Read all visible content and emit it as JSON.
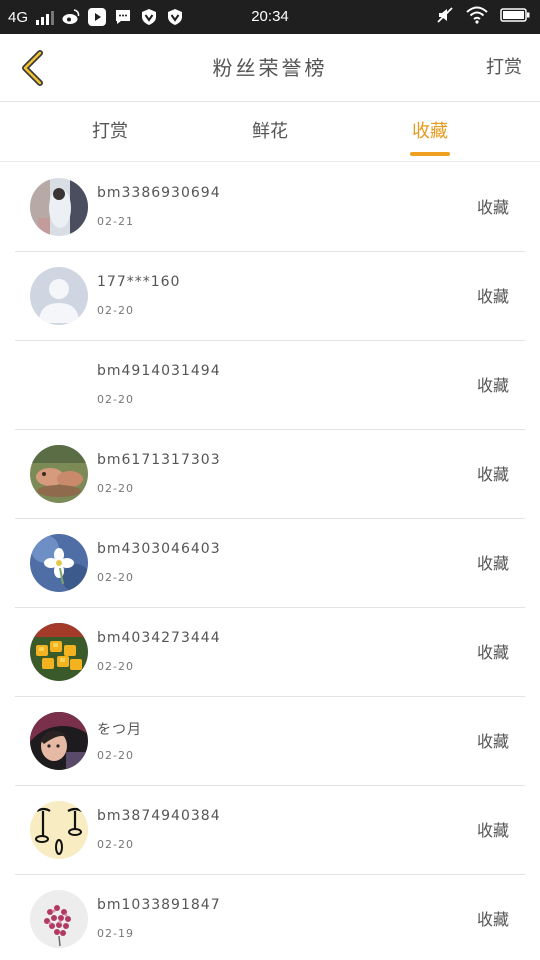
{
  "status_bar": {
    "network": "4G",
    "time": "20:34",
    "app_icons": [
      "weibo-icon",
      "video-play-icon",
      "chat-bubble-icon",
      "vpn-shield-icon",
      "vpn-shield-icon"
    ]
  },
  "header": {
    "title": "粉丝荣誉榜",
    "action": "打赏"
  },
  "tabs": [
    {
      "label": "打赏",
      "active": false
    },
    {
      "label": "鲜花",
      "active": false
    },
    {
      "label": "收藏",
      "active": true
    }
  ],
  "accent_color": "#f0a020",
  "row_action_label": "收藏",
  "fans": [
    {
      "name": "bm3386930694",
      "date": "02-21"
    },
    {
      "name": "177***160",
      "date": "02-20"
    },
    {
      "name": "bm4914031494",
      "date": "02-20"
    },
    {
      "name": "bm6171317303",
      "date": "02-20"
    },
    {
      "name": "bm4303046403",
      "date": "02-20"
    },
    {
      "name": "bm4034273444",
      "date": "02-20"
    },
    {
      "name": "をつ月",
      "date": "02-20"
    },
    {
      "name": "bm3874940384",
      "date": "02-20"
    },
    {
      "name": "bm1033891847",
      "date": "02-19"
    }
  ]
}
